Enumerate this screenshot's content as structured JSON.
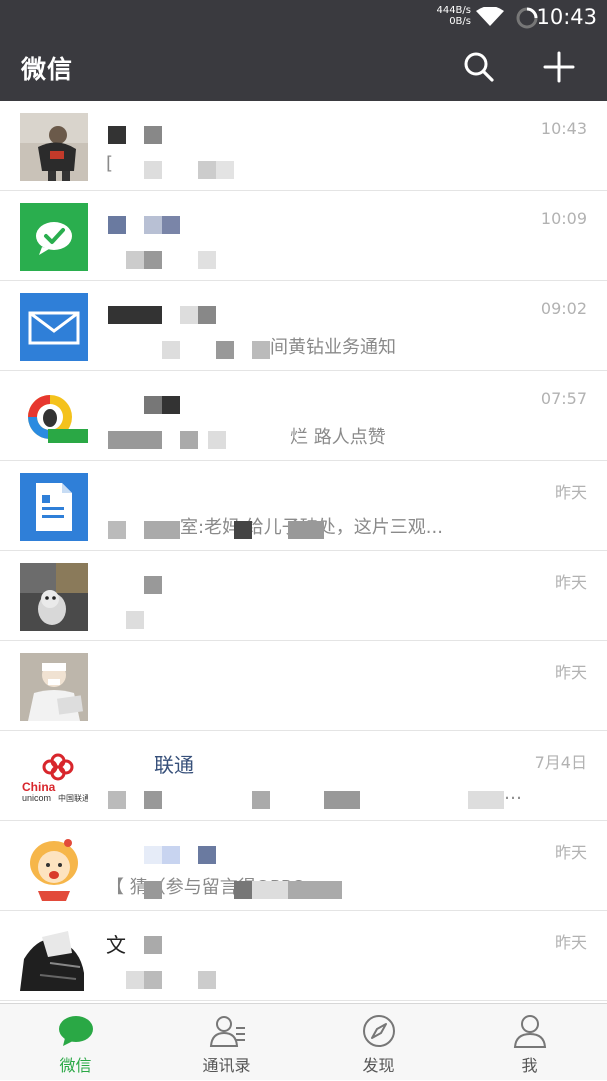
{
  "status_bar": {
    "net_speed_up": "444B/s",
    "net_speed_down": "0B/s",
    "time": "10:43"
  },
  "app_bar": {
    "title": "微信",
    "search_icon": "search-icon",
    "add_icon": "plus-icon"
  },
  "chats": [
    {
      "name": "",
      "preview": "[",
      "time": "10:43",
      "avatar": "photo-person"
    },
    {
      "name": "",
      "preview": "",
      "time": "10:09",
      "avatar": "wechat-pay-green"
    },
    {
      "name": "",
      "preview": "间黄钻业务通知",
      "time": "09:02",
      "avatar": "mail-blue"
    },
    {
      "name": "",
      "preview": "烂 路人点赞",
      "time": "07:57",
      "avatar": "qq-colorful"
    },
    {
      "name": "",
      "preview": "室:老妈    给儿子破处，这片三观...",
      "time": "昨天",
      "avatar": "doc-blue"
    },
    {
      "name": "",
      "preview": "",
      "time": "昨天",
      "avatar": "photo-dog"
    },
    {
      "name": "",
      "preview": "",
      "time": "昨天",
      "avatar": "photo-man"
    },
    {
      "name": "联通",
      "preview": "…",
      "time": "7月4日",
      "avatar": "china-unicom"
    },
    {
      "name": "",
      "preview": "【    猜（参与留言得OPPO...",
      "time": "昨天",
      "avatar": "cartoon-girl"
    },
    {
      "name": "文",
      "preview": "",
      "time": "昨天",
      "avatar": "photo-dark"
    }
  ],
  "tabs": [
    {
      "label": "微信",
      "icon": "chat-bubble-icon",
      "active": true
    },
    {
      "label": "通讯录",
      "icon": "contacts-icon",
      "active": false
    },
    {
      "label": "发现",
      "icon": "compass-icon",
      "active": false
    },
    {
      "label": "我",
      "icon": "person-icon",
      "active": false
    }
  ],
  "colors": {
    "header_bg": "#3a3a3f",
    "accent_green": "#2aa845",
    "time_gray": "#b2b2b2",
    "preview_gray": "#8a8a8a"
  }
}
